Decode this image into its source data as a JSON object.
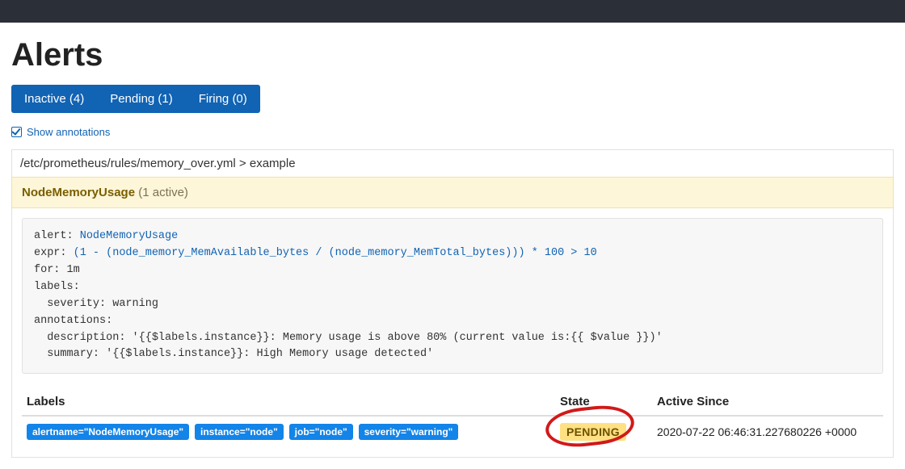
{
  "header": {
    "title": "Alerts"
  },
  "filters": {
    "inactive_label": "Inactive (4)",
    "pending_label": "Pending (1)",
    "firing_label": "Firing (0)"
  },
  "show_annotations_label": "Show annotations",
  "group_path": "/etc/prometheus/rules/memory_over.yml > example",
  "rule": {
    "name": "NodeMemoryUsage",
    "count_label": "(1 active)",
    "code": {
      "alert_kw": "alert: ",
      "alert_val": "NodeMemoryUsage",
      "expr_kw": "expr: ",
      "expr_val": "(1 - (node_memory_MemAvailable_bytes / (node_memory_MemTotal_bytes))) * 100 > 10",
      "for_line": "for: 1m",
      "labels_line": "labels:",
      "severity_line": "  severity: warning",
      "annotations_line": "annotations:",
      "description_line": "  description: '{{$labels.instance}}: Memory usage is above 80% (current value is:{{ $value }})'",
      "summary_line": "  summary: '{{$labels.instance}}: High Memory usage detected'"
    }
  },
  "table": {
    "headers": {
      "labels": "Labels",
      "state": "State",
      "active_since": "Active Since"
    },
    "row": {
      "labels": [
        "alertname=\"NodeMemoryUsage\"",
        "instance=\"node\"",
        "job=\"node\"",
        "severity=\"warning\""
      ],
      "state": "PENDING",
      "active_since": "2020-07-22 06:46:31.227680226 +0000"
    }
  }
}
